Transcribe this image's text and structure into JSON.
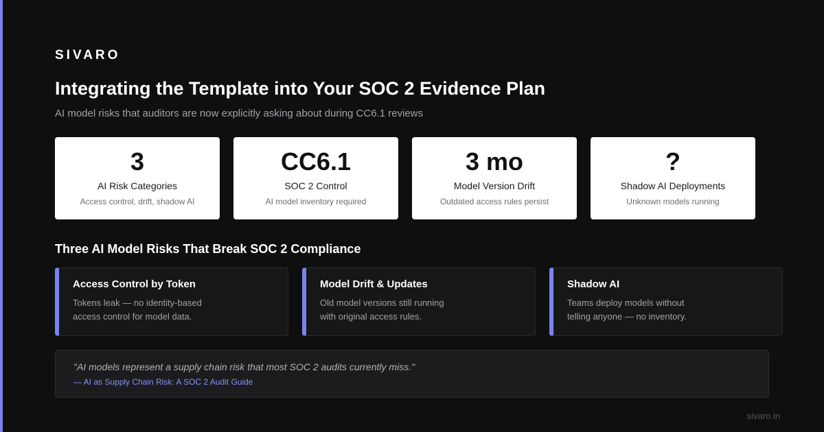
{
  "brand": "SIVARO",
  "title": "Integrating the Template into Your SOC 2 Evidence Plan",
  "subtitle": "AI model risks that auditors are now explicitly asking about during CC6.1 reviews",
  "stats": [
    {
      "value": "3",
      "label": "AI Risk Categories",
      "desc": "Access control, drift, shadow AI"
    },
    {
      "value": "CC6.1",
      "label": "SOC 2 Control",
      "desc": "AI model inventory required"
    },
    {
      "value": "3 mo",
      "label": "Model Version Drift",
      "desc": "Outdated access rules persist"
    },
    {
      "value": "?",
      "label": "Shadow AI Deployments",
      "desc": "Unknown models running"
    }
  ],
  "section_title": "Three AI Model Risks That Break SOC 2 Compliance",
  "risks": [
    {
      "title": "Access Control by Token",
      "desc": "Tokens leak — no identity-based access control for model data."
    },
    {
      "title": "Model Drift & Updates",
      "desc": "Old model versions still running with original access rules."
    },
    {
      "title": "Shadow AI",
      "desc": "Teams deploy models without telling anyone — no inventory."
    }
  ],
  "quote": {
    "text": "\"AI models represent a supply chain risk that most SOC 2 audits currently miss.\"",
    "source": "— AI as Supply Chain Risk: A SOC 2 Audit Guide"
  },
  "footer_url": "sivaro.in",
  "colors": {
    "accent": "#7b83f0",
    "background": "#0f0f10",
    "card": "#ffffff",
    "risk_card": "#17171a"
  }
}
